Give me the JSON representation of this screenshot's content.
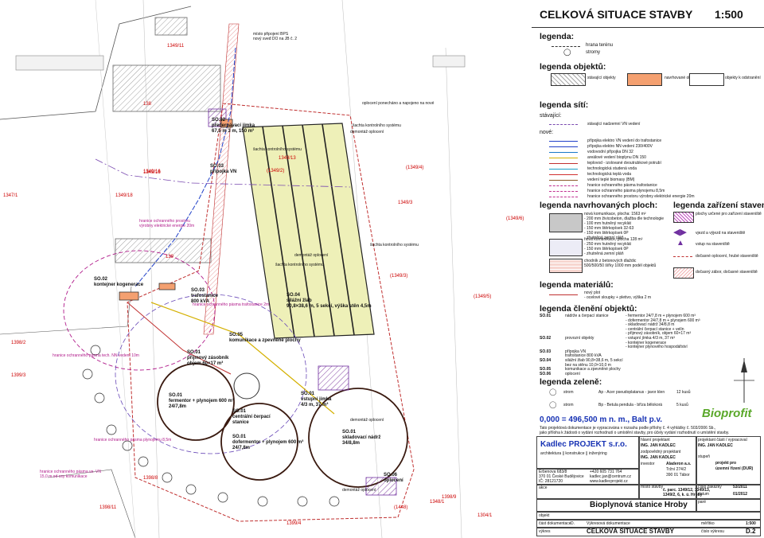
{
  "title": {
    "main": "CELKOVÁ SITUACE STAVBY",
    "scale": "1:500"
  },
  "legend": {
    "heading": "legenda:",
    "items": [
      {
        "label": "hrana terénu",
        "icon": "terrain-edge-icon"
      },
      {
        "label": "stromy",
        "icon": "tree-icon"
      }
    ]
  },
  "legend_objects": {
    "heading": "legenda objektů:",
    "items": [
      {
        "label": "stávající objekty",
        "color": "#cfcfcf"
      },
      {
        "label": "navrhované objekty",
        "color": "#f4a070"
      },
      {
        "label": "objekty k odstranění",
        "color": "#ffffff"
      }
    ]
  },
  "legend_networks": {
    "heading": "legenda sítí:",
    "existing_heading": "stávající:",
    "existing": [
      {
        "label": "stávající nadzemní VN vedení",
        "color": "#7a4ab0"
      }
    ],
    "new_heading": "nové:",
    "new": [
      {
        "label": "přípojka elektro VN vedení do trafostanice",
        "color": "#2040c8"
      },
      {
        "label": "přípojka elektro NN vedení 230/400V",
        "color": "#2040c8"
      },
      {
        "label": "vodovodní přípojka DN 32",
        "color": "#1a78c8"
      },
      {
        "label": "areálové vedení bioplynu DN 150",
        "color": "#d4b000"
      },
      {
        "label": "teplovod - izolované dvoutrubkové potrubí",
        "color": "#c03030"
      },
      {
        "label": "technologická studená voda",
        "color": "#1aa0c8"
      },
      {
        "label": "technologická teplá voda",
        "color": "#d03030"
      },
      {
        "label": "vedení teplé biomasy (BM)",
        "color": "#8a5a2a"
      },
      {
        "label": "hranice ochranného pásma trafostanice",
        "color": "#c03090"
      },
      {
        "label": "hranice ochranného pásma plynojemu 8,5m",
        "color": "#c03090"
      },
      {
        "label": "hranice ochranného prostoru výrobny elektrické energie 20m",
        "color": "#c03090"
      }
    ]
  },
  "legend_areas": {
    "heading": "legenda navrhovaných ploch:",
    "items": [
      {
        "lines": [
          "nová komunikace, plocha: 1563 m²",
          "- 200 mm živicobeton, dlažba dle technologie",
          "- 100 mm hutněný recyklát",
          "- 150 mm štěrkopísek 32-63",
          "- 150 mm štěrkopísek 0P",
          "- zhutněná zemní pláň"
        ],
        "color": "#c8c8c8"
      },
      {
        "lines": [
          "nová komunikace, plocha 128 m²",
          "- 250 mm hutněný recyklát",
          "- 150 mm štěrkopísek 0P",
          "- zhutněná zemní pláň"
        ],
        "color": "#e8e8f4"
      },
      {
        "lines": [
          "chodník z betonových dlaždic",
          "500/500/50 šířky 1000 mm podél objektů"
        ],
        "color": "#f3c6c6"
      }
    ]
  },
  "legend_equipment": {
    "heading": "legenda zařízení staveniště:",
    "items": [
      {
        "label": "plochy určené pro zařízení staveniště",
        "color": "#c050c0"
      },
      {
        "label": "vjezd a výjezd na staveniště",
        "color": "#7030a0"
      },
      {
        "label": "vstup na staveniště",
        "color": "#7030a0"
      },
      {
        "label": "dočasné oplocení, hrubé staveniště",
        "color": "#c03030"
      },
      {
        "label": "dočasný zábor, dočasné staveniště",
        "color": "#c03030"
      }
    ]
  },
  "legend_materials": {
    "heading": "legenda materiálů:",
    "items": [
      {
        "label": "nový plot",
        "sub": "- ocelové sloupky + pletivo, výška 2 m",
        "color": "#c03030"
      }
    ]
  },
  "legend_structure": {
    "heading": "legenda členění objektů:",
    "rows": [
      {
        "code": "SO.01",
        "name": "nádrže a čerpací stanice",
        "detail": "- fermentor 24/7,8 m + plynojem 600 m³"
      },
      {
        "code": "",
        "name": "",
        "detail": "- dofermentor 24/7,8 m + plynojem 600 m³"
      },
      {
        "code": "",
        "name": "",
        "detail": "- skladovací nádrž 34/8,8 m"
      },
      {
        "code": "",
        "name": "",
        "detail": "- centrální čerpací stanice + velín"
      },
      {
        "code": "",
        "name": "",
        "detail": "- přijmový zásobník, objem 60×17 m³"
      },
      {
        "code": "SO.02",
        "name": "provozní objekty",
        "detail": "- vstupní jímka 4/3 m, 37 m³"
      },
      {
        "code": "",
        "name": "",
        "detail": "- kontejner kogenerace"
      },
      {
        "code": "",
        "name": "",
        "detail": "- kontejner plynového hospodářství"
      },
      {
        "code": "SO.03",
        "name": "přípojka VN",
        "detail": ""
      },
      {
        "code": "",
        "name": "trafostanice 800 kVA",
        "detail": ""
      },
      {
        "code": "SO.04",
        "name": "silážní žlab 90,8×38,6 m, 5 sekcí",
        "detail": ""
      },
      {
        "code": "",
        "name": "bez na stěnu 10,0×10,0 m",
        "detail": ""
      },
      {
        "code": "SO.05",
        "name": "komunikace a zpevněné plochy",
        "detail": ""
      },
      {
        "code": "SO.06",
        "name": "oplocení",
        "detail": ""
      }
    ]
  },
  "legend_greenery": {
    "heading": "legenda zeleně:",
    "items": [
      {
        "label": "strom",
        "species": "Ap - Acer pseudoplatanus - javor klen",
        "count": "12 kusů"
      },
      {
        "label": "strom",
        "species": "Bp - Betula pendula - bříza bělokorá",
        "count": "5 kusů"
      }
    ]
  },
  "datum": {
    "line": "0,000 = 496,500 m n. m., Balt p.v.",
    "note1": "Tato projektová dokumentace je vypracována v rozsahu podle přílohy č. 4 vyhlášky č. 503/2006 Sb.,",
    "note2": "jako příloha k žádosti o vydání rozhodnutí o umístění stavby, pro účely vydání rozhodnutí o umístění stavby."
  },
  "brand": {
    "name": "Bioprofit",
    "color": "#5aa82a"
  },
  "title_block": {
    "company": "Kadlec PROJEKT s.r.o.",
    "company_sub": "architektura ∥ konstrukce ∥ inženýring",
    "address": [
      "Erbenova 683/8",
      "370 01 České Budějovice",
      "IČ: 28121720"
    ],
    "contacts": [
      "+420 605 731 764",
      "kadlec.jan@centrum.cz",
      "www.kadlecprojekt.cz"
    ],
    "chief_label": "hlavní projektant",
    "chief": "ING. JAN KADLEC",
    "responsible_label": "zodpovědný projektant",
    "responsible": "ING. JAN KADLEC",
    "investor_label": "investor",
    "investor": [
      "Aladeron a.s.",
      "Tržní 274/2",
      "390 01 Tábor"
    ],
    "site_label": "místo stavby",
    "site": [
      "č. parc. 1349/12, 1349/13,",
      "1349/2, 6, k. ú. Hroby"
    ],
    "author_label": "projektant části / vypracoval",
    "author": "ING. JAN KADLEC",
    "stage_label": "stupeň",
    "stage": [
      "projekt pro",
      "územní řízení (DUR)"
    ],
    "order_label": "číslo zakázky",
    "order": "53/2011",
    "date_label": "datum",
    "date": "01/2012",
    "project_label": "akce",
    "project": "Bioplynová stanice Hroby",
    "object_label": "objekt",
    "part_label": "část dokumentace",
    "part_code": "D.",
    "part": "Výkresová dokumentace",
    "scale_label": "měřítko",
    "scale": "1:500",
    "drawing_label": "výkres",
    "drawing": "CELKOVÁ SITUACE STAVBY",
    "sheet_label": "číslo výkresu",
    "sheet": "D.2",
    "format_label": "paré"
  },
  "plan": {
    "parcels": [
      "1349/16",
      "1349/18",
      "1349/13",
      "(1349/2)",
      "(1349/4)",
      "(1349/5)",
      "(1349/6)",
      "1349/3",
      "(1349/3)",
      "1347/1",
      "1398/2",
      "1399/3",
      "1398/11",
      "1399/4",
      "1398/8",
      "1348/1",
      "1304/1",
      "1398/9",
      "(1448)",
      "139",
      "138",
      "1349/11"
    ],
    "object_labels": [
      {
        "code": "SO.04",
        "text": [
          "SO.04",
          "silážní žlab",
          "90,8×38,6 m, 5 sekcí, výška stěn 4,5m"
        ]
      },
      {
        "code": "SO.01-fermentor",
        "text": [
          "SO.01",
          "fermentor + plynojem 600 m³",
          "24/7,8m"
        ]
      },
      {
        "code": "SO.01-dofermentor",
        "text": [
          "SO.01",
          "dofermentor + plynojem 600 m³",
          "24/7,8m"
        ]
      },
      {
        "code": "SO.01-storage",
        "text": [
          "SO.01",
          "skladovací nádrž",
          "34/8,8m"
        ]
      },
      {
        "code": "SO.01-pump",
        "text": [
          "SO.01",
          "centrální čerpací",
          "stanice"
        ]
      },
      {
        "code": "SO.01-hopper",
        "text": [
          "SO.01",
          "přijmový zásobník",
          "objem 60×17 m³"
        ]
      },
      {
        "code": "SO.02",
        "text": [
          "SO.02",
          "kontejner kogenerace"
        ]
      },
      {
        "code": "SO.03",
        "text": [
          "SO.03",
          "trafostanice",
          "800 kVA"
        ]
      },
      {
        "code": "SO.05",
        "text": [
          "SO.05",
          "komunikace a zpevněné plochy"
        ]
      },
      {
        "code": "SO.02-pit",
        "text": [
          "SO.02",
          "přečerpávací jímka",
          "67,5 m 3 m, 150 m³"
        ]
      },
      {
        "code": "SO.02-inlet",
        "text": [
          "SO.01",
          "vstupní jímka",
          "4/3 m, 37 m³"
        ]
      },
      {
        "code": "SO.06",
        "text": [
          "SO.06",
          "oplocení"
        ]
      },
      {
        "code": "SO.03-line",
        "text": [
          "SO.03",
          "přípojka VN"
        ]
      }
    ],
    "notes": [
      "místo připojení BPS",
      "nový sveđ DO na JB č. 2",
      "oplocení ponecháno a napojeno na nové",
      "šachta kontrolního systému",
      "demontáž oplocení",
      "hranice ochranného prostoru",
      "výrobny elektrické energie 20m",
      "hranice ochranného pásma trafostanice 2m",
      "hranice ochranného pásma plynojemu 8,5m",
      "hranice ochranného pásma tech. NN vedení 10m",
      "hranice ochranného pásma ve. VN",
      "15,0 m od osy komunikace"
    ]
  }
}
